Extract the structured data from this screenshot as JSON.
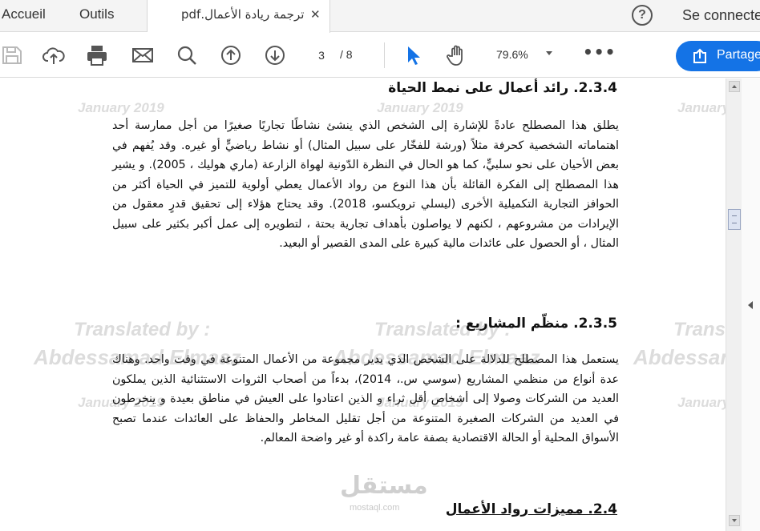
{
  "tabs": {
    "home": "Accueil",
    "tools": "Outils",
    "document": "ترجمة ريادة الأعمال.pdf",
    "close": "✕"
  },
  "header": {
    "help": "?",
    "signin": "Se connecter"
  },
  "toolbar": {
    "current_page": "3",
    "total_pages": "/ 8",
    "zoom": "79.6%",
    "more": "•••",
    "share_label": "Partager"
  },
  "document": {
    "watermarks": {
      "date": "January 2019",
      "translated": "Translated by :",
      "translator": "Abdessamad Elmaaz"
    },
    "logo": "مستقل",
    "logo_sub": "mostaql.com",
    "sections": [
      {
        "heading": "2.3.4. رائد أعمال على نمط الحياة",
        "paragraph": "يطلق هذا المصطلح عادةً للإشارة إلى الشخص الذي ينشئ نشاطًا تجاريًا صغيرًا من أجل ممارسة أحد اهتماماته الشخصية كحرفة مثلاً (ورشة للفخّار على سبيل المثال) أو نشاط رياضيٍّ أو غيره. وقد يُفهم في بعض الأحيان على نحو سلبيٍّ، كما هو الحال في النظرة الدّونية لهواة الزارعة (ماري هوليك ، 2005). و يشير هذا المصطلح إلى الفكرة القائلة بأن هذا النوع من رواد الأعمال يعطي أولوية للتميز في الحياة أكثر من الحوافز التجارية التكميلية الأخرى (ليسلي ترويكسو، 2018). وقد يحتاج هؤلاء إلى تحقيق قدرٍ معقول من الإيرادات من مشروعهم ، لكنهم لا يواصلون بأهداف تجارية بحتة ، لتطويره إلى عمل أكبر بكثير على سبيل المثال ، أو الحصول على عائدات مالية كبيرة على المدى القصير أو البعيد."
      },
      {
        "heading": "2.3.5. منظّم المشاريع :",
        "paragraph": "يستعمل هذا المصطلح للدلالة على الشخص الذي يدير مجموعة من الأعمال المتنوعة في وقت واحد. وهناك عدة أنواع من منظمي المشاريع (سوسي س.، 2014)، بدءاً من أصحاب الثروات الاستثنائية الذين يملكون العديد من الشركات وصولا إلى أشخاص أقل ثراء و الذين اعتادوا على العيش في مناطق بعيدة و ينخرطون في العديد من الشركات الصغيرة المتنوعة من أجل تقليل المخاطر والحفاظ على العائدات عندما تصبح الأسواق المحلية أو الحالة الاقتصادية بصفة عامة راكدة أو غير واضحة المعالم."
      },
      {
        "heading": "2.4. مميزات رواد الأعمال"
      }
    ]
  },
  "colors": {
    "accent": "#1473e6",
    "cursor_tool": "#1473e6"
  }
}
